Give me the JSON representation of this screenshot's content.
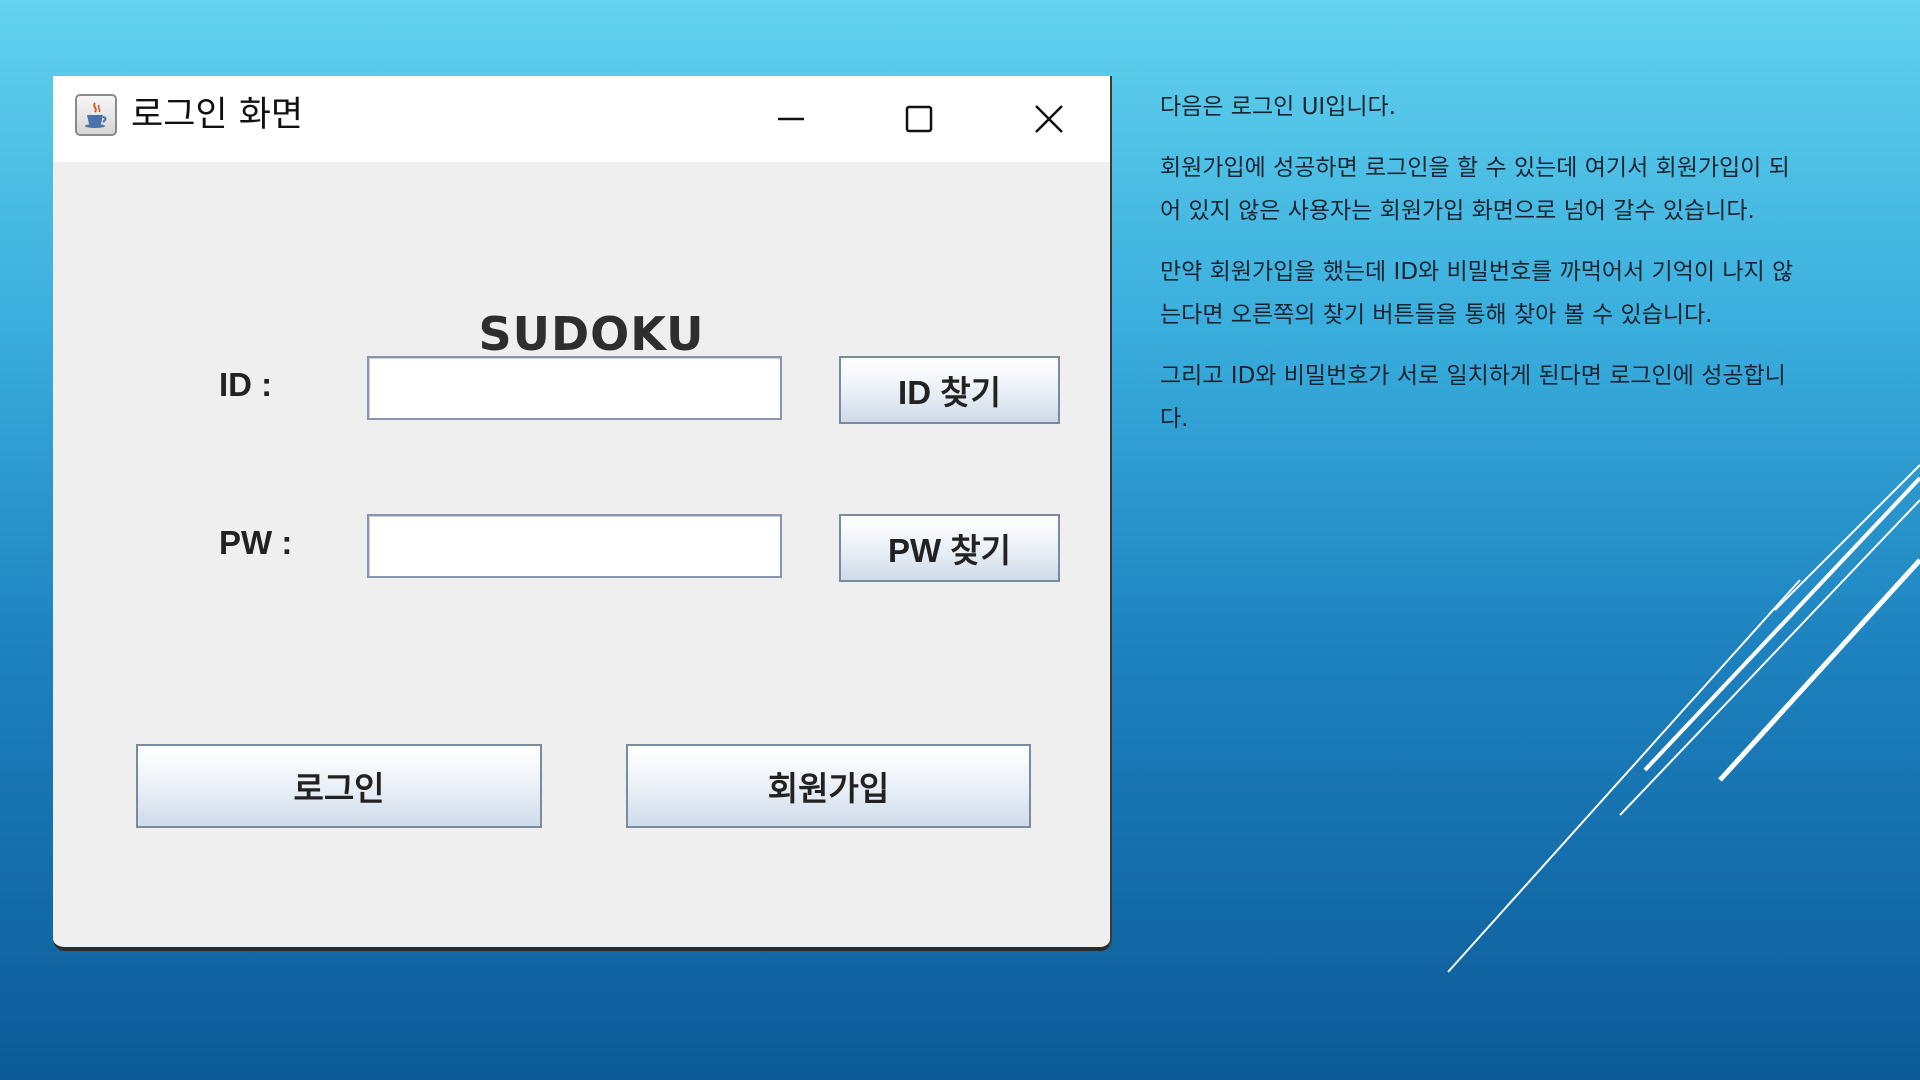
{
  "window": {
    "title": "로그인 화면",
    "minimize_glyph": "—",
    "maximize_glyph": "☐",
    "close_glyph": "✕"
  },
  "form": {
    "heading": "SUDOKU",
    "id_label": "ID :",
    "pw_label": "PW :",
    "id_value": "",
    "pw_value": "",
    "find_id_button": "ID 찾기",
    "find_pw_button": "PW 찾기",
    "login_button": "로그인",
    "signup_button": "회원가입"
  },
  "description": {
    "paragraphs": [
      "다음은 로그인 UI입니다.",
      "회원가입에 성공하면 로그인을 할 수 있는데 여기서 회원가입이 되어 있지 않은 사용자는 회원가입 화면으로 넘어 갈수 있습니다.",
      "만약 회원가입을 했는데 ID와 비밀번호를 까먹어서 기억이 나지 않는다면 오른쪽의 찾기 버튼들을 통해 찾아 볼 수 있습니다.",
      "그리고 ID와 비밀번호가 서로 일치하게 된다면 로그인에 성공합니다."
    ]
  },
  "colors": {
    "background_top": "#62d2ee",
    "background_bottom": "#0c5a98",
    "window_body": "#efefef",
    "button_gradient_end": "#cfdbea"
  },
  "icons": {
    "app": "java-coffee-cup-icon",
    "minimize": "minimize-icon",
    "maximize": "maximize-icon",
    "close": "close-icon"
  }
}
